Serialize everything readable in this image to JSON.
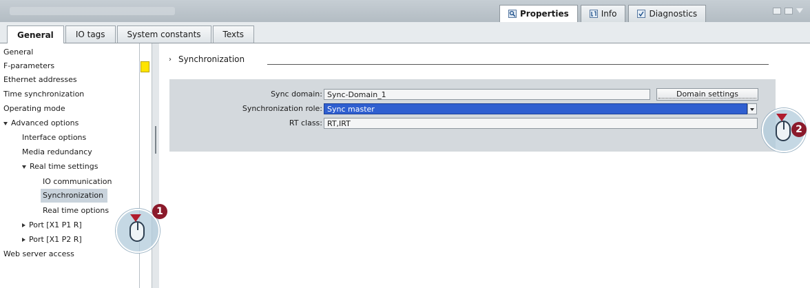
{
  "inspector_tabs": [
    {
      "label": "Properties",
      "active": true,
      "icon": "properties-icon"
    },
    {
      "label": "Info",
      "active": false,
      "icon": "info-icon"
    },
    {
      "label": "Diagnostics",
      "active": false,
      "icon": "diagnostics-icon"
    }
  ],
  "section_tabs": [
    {
      "label": "General",
      "active": true
    },
    {
      "label": "IO tags",
      "active": false
    },
    {
      "label": "System constants",
      "active": false
    },
    {
      "label": "Texts",
      "active": false
    }
  ],
  "nav_items": [
    {
      "label": "General",
      "level": 0,
      "expander": "none"
    },
    {
      "label": "F-parameters",
      "level": 0,
      "expander": "none"
    },
    {
      "label": "Ethernet addresses",
      "level": 0,
      "expander": "none"
    },
    {
      "label": "Time synchronization",
      "level": 0,
      "expander": "none"
    },
    {
      "label": "Operating mode",
      "level": 0,
      "expander": "none"
    },
    {
      "label": "Advanced options",
      "level": 0,
      "expander": "expanded"
    },
    {
      "label": "Interface options",
      "level": 1,
      "expander": "none"
    },
    {
      "label": "Media redundancy",
      "level": 1,
      "expander": "none"
    },
    {
      "label": "Real time settings",
      "level": 1,
      "expander": "expanded"
    },
    {
      "label": "IO communication",
      "level": 2,
      "expander": "none"
    },
    {
      "label": "Synchronization",
      "level": 2,
      "expander": "none",
      "selected": true
    },
    {
      "label": "Real time options",
      "level": 2,
      "expander": "none"
    },
    {
      "label": "Port [X1 P1 R]",
      "level": 1,
      "expander": "collapsed"
    },
    {
      "label": "Port [X1 P2 R]",
      "level": 1,
      "expander": "collapsed"
    },
    {
      "label": "Web server access",
      "level": 0,
      "expander": "none"
    }
  ],
  "section": {
    "title": "Synchronization"
  },
  "fields": {
    "sync_domain_label": "Sync domain:",
    "sync_domain_value": "Sync-Domain_1",
    "domain_settings_button": "Domain settings",
    "sync_role_label": "Synchronization role:",
    "sync_role_value": "Sync master",
    "rt_class_label": "RT class:",
    "rt_class_value": "RT,IRT"
  },
  "callouts": [
    {
      "number": "1",
      "target": "Synchronization"
    },
    {
      "number": "2",
      "target": "Synchronization role dropdown"
    }
  ],
  "colors": {
    "selection_blue": "#2f5fd0",
    "marker_yellow": "#ffe400",
    "callout_red": "#8b1a2b"
  }
}
